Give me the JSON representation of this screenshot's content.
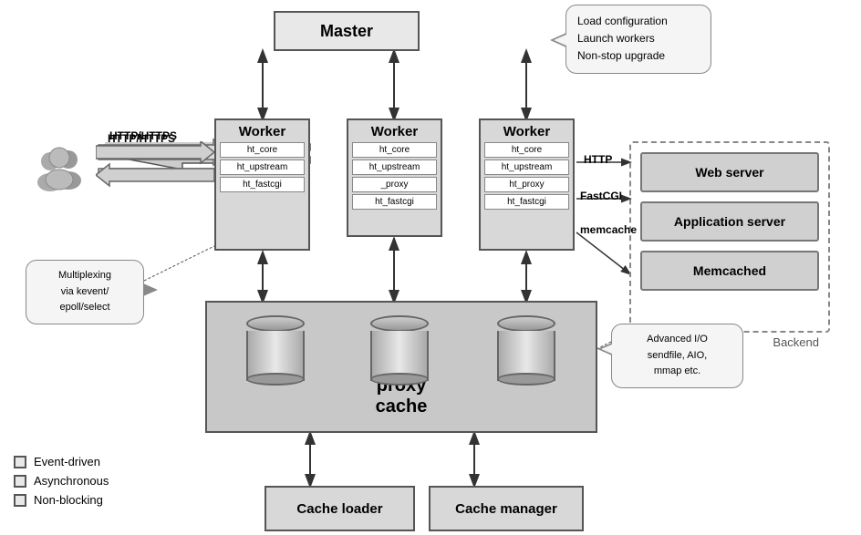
{
  "master": {
    "label": "Master",
    "bubble": {
      "line1": "Load configuration",
      "line2": "Launch workers",
      "line3": "Non-stop upgrade"
    }
  },
  "workers": [
    {
      "id": "worker1",
      "title": "Worker",
      "modules": [
        "ht_core",
        "ht_upstream",
        "ht_fastcgi"
      ]
    },
    {
      "id": "worker2",
      "title": "Worker",
      "modules": [
        "ht_core",
        "ht_upstream",
        "_proxy",
        "ht_fastcgi"
      ]
    },
    {
      "id": "worker3",
      "title": "Worker",
      "modules": [
        "ht_core",
        "ht_upstream",
        "ht_proxy",
        "ht_fastcgi"
      ]
    }
  ],
  "proxy_cache": {
    "label": "proxy\ncache"
  },
  "cache_loader": {
    "label": "Cache loader"
  },
  "cache_manager": {
    "label": "Cache manager"
  },
  "backend": {
    "label": "Backend",
    "items": [
      "Web server",
      "Application server",
      "Memcached"
    ]
  },
  "labels": {
    "http_https": "HTTP/HTTPS",
    "http": "HTTP",
    "fastcgi": "FastCGI",
    "memcache": "memcache"
  },
  "multiplexing_bubble": {
    "text": "Multiplexing\nvia kevent/\nepoll/select"
  },
  "advio_bubble": {
    "text": "Advanced I/O\nsendfile, AIO,\nmmap etc."
  },
  "legend": {
    "items": [
      "Event-driven",
      "Asynchronous",
      "Non-blocking"
    ]
  }
}
